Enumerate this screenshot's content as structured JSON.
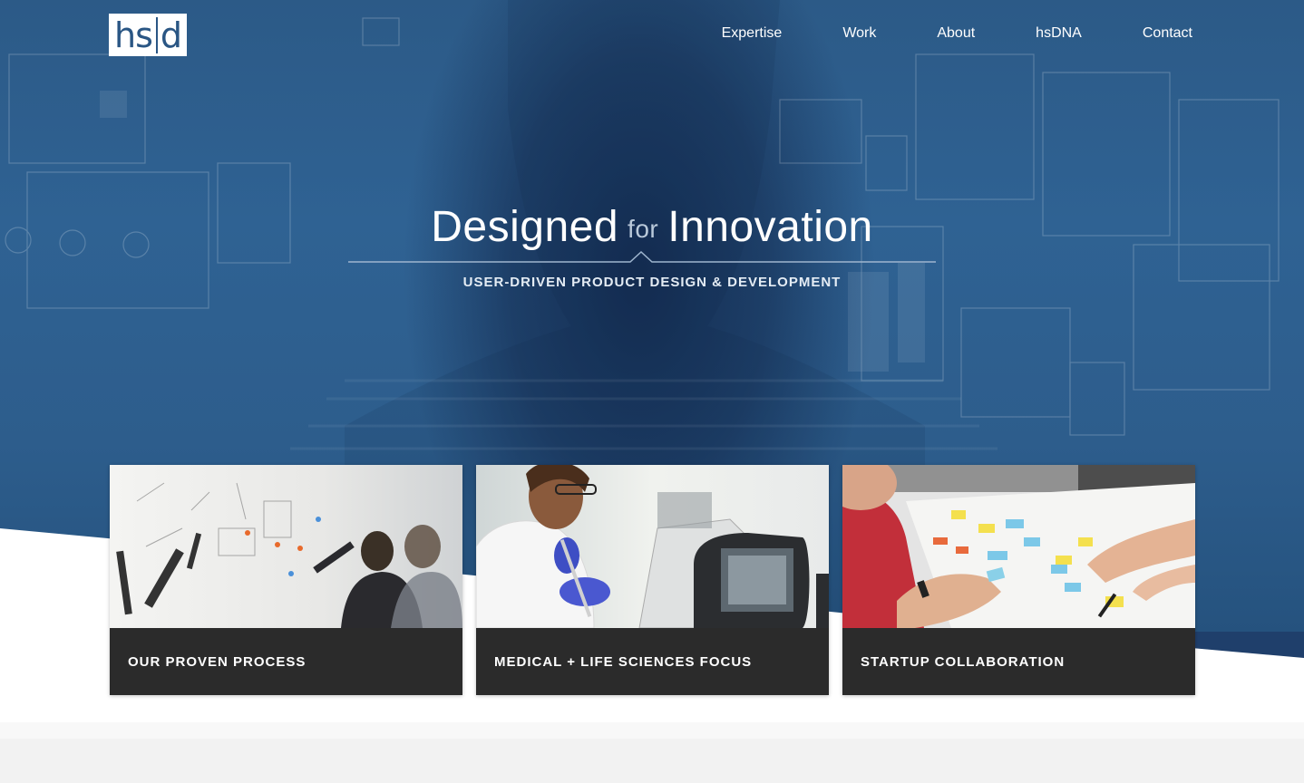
{
  "header": {
    "logo_text_left": "hs",
    "logo_text_right": "d",
    "nav": [
      "Expertise",
      "Work",
      "About",
      "hsDNA",
      "Contact"
    ]
  },
  "hero": {
    "title_left": "Designed",
    "title_mid": "for",
    "title_right": "Innovation",
    "subtitle": "USER-DRIVEN PRODUCT DESIGN & DEVELOPMENT"
  },
  "cards": [
    {
      "label": "OUR PROVEN PROCESS",
      "image": "designers-at-whiteboard"
    },
    {
      "label": "MEDICAL + LIFE SCIENCES FOCUS",
      "image": "scientist-with-pipette"
    },
    {
      "label": "STARTUP COLLABORATION",
      "image": "team-with-sticky-notes"
    }
  ],
  "colors": {
    "hero_blue": "#2d5d8c",
    "dark_navy": "#1f3f6b",
    "card_caption": "#2b2b2b",
    "logo_blue": "#2a5684"
  }
}
